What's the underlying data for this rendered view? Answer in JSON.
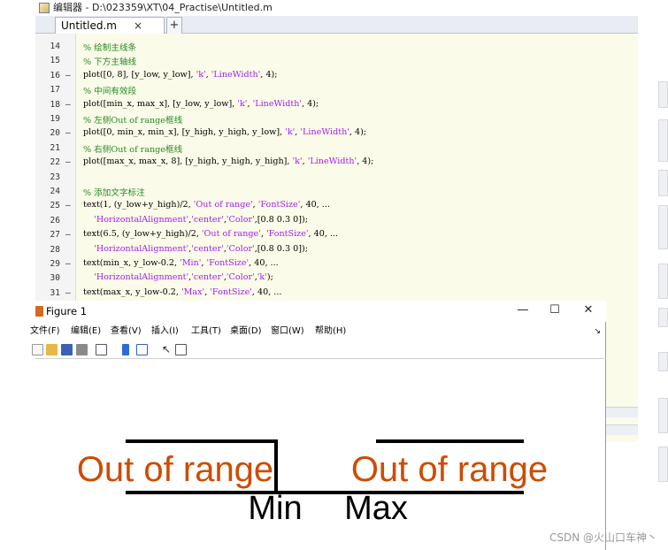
{
  "editor": {
    "title": "编辑器 - D:\\023359\\XT\\04_Practise\\Untitled.m",
    "tab_label": "Untitled.m",
    "tab_close": "×",
    "tab_add": "+",
    "line_numbers": [
      "14",
      "15",
      "16",
      "17",
      "18",
      "19",
      "20",
      "21",
      "22",
      "23",
      "24",
      "25",
      "26",
      "27",
      "28",
      "29",
      "30",
      "31"
    ],
    "line_dashes": [
      "",
      "",
      "–",
      "",
      "–",
      "",
      "–",
      "",
      "–",
      "",
      "",
      "–",
      "",
      "–",
      "",
      "–",
      "",
      "–"
    ],
    "code_lines": [
      {
        "t": "% 绘制主线条",
        "c": true
      },
      {
        "t": "% 下方主轴线",
        "c": true
      },
      {
        "t": "plot([0, 8], [y_low, y_low], 'k', 'LineWidth', 4);",
        "c": false
      },
      {
        "t": "% 中间有效段",
        "c": true
      },
      {
        "t": "plot([min_x, max_x], [y_low, y_low], 'k', 'LineWidth', 4);",
        "c": false
      },
      {
        "t": "% 左侧Out of range框线",
        "c": true
      },
      {
        "t": "plot([0, min_x, min_x], [y_high, y_high, y_low], 'k', 'LineWidth', 4);",
        "c": false
      },
      {
        "t": "% 右侧Out of range框线",
        "c": true
      },
      {
        "t": "plot([max_x, max_x, 8], [y_high, y_high, y_high], 'k', 'LineWidth', 4);",
        "c": false
      },
      {
        "t": "",
        "c": false
      },
      {
        "t": "% 添加文字标注",
        "c": true
      },
      {
        "t": "text(1, (y_low+y_high)/2, 'Out of range', 'FontSize', 40, ...",
        "c": false
      },
      {
        "t": "    'HorizontalAlignment','center','Color',[0.8 0.3 0]);",
        "c": false
      },
      {
        "t": "text(6.5, (y_low+y_high)/2, 'Out of range', 'FontSize', 40, ...",
        "c": false
      },
      {
        "t": "    'HorizontalAlignment','center','Color',[0.8 0.3 0]);",
        "c": false
      },
      {
        "t": "text(min_x, y_low-0.2, 'Min', 'FontSize', 40, ...",
        "c": false
      },
      {
        "t": "    'HorizontalAlignment','center','Color','k');",
        "c": false
      },
      {
        "t": "text(max_x, y_low-0.2, 'Max', 'FontSize', 40, ...",
        "c": false
      }
    ]
  },
  "figure": {
    "title": "Figure 1",
    "minimize": "—",
    "maximize": "☐",
    "close": "✕",
    "menus": [
      "文件(F)",
      "编辑(E)",
      "查看(V)",
      "插入(I)",
      "工具(T)",
      "桌面(D)",
      "窗口(W)",
      "帮助(H)"
    ],
    "menu_arrow": "↘",
    "toolbar_icons": [
      "new-figure-icon",
      "open-file-icon",
      "save-icon",
      "print-icon",
      "link-icon",
      "colorbar-icon",
      "legend-icon",
      "pointer-icon",
      "property-editor-icon"
    ],
    "plot": {
      "label_left": "Out of range",
      "label_right": "Out of range",
      "label_min": "Min",
      "label_max": "Max",
      "text_color": "#cc4c00",
      "line_color": "#000000"
    }
  },
  "watermark": "CSDN @火山口车神丶"
}
